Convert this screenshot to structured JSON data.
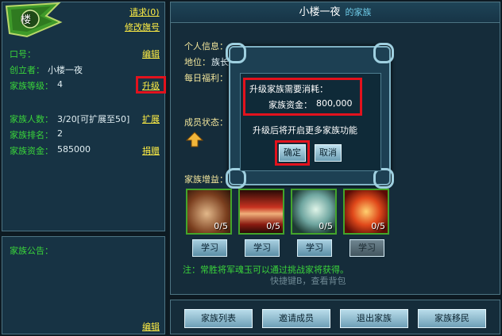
{
  "clan_badge": {
    "char": "楼"
  },
  "left": {
    "request_link": "请求(0)",
    "edit_flag_link": "修改旗号",
    "slogan_label": "口号：",
    "slogan_edit_link": "编辑",
    "creator_label": "创立者：",
    "creator_value": "小楼一夜",
    "level_label": "家族等级：",
    "level_value": "4",
    "upgrade_link": "升级",
    "members_label": "家族人数：",
    "members_value": "3/20[可扩展至50]",
    "expand_link": "扩展",
    "rank_label": "家族排名：",
    "rank_value": "2",
    "funds_label": "家族资金：",
    "funds_value": "585000",
    "donate_link": "捐赠"
  },
  "notice": {
    "label": "家族公告：",
    "edit_link": "编辑"
  },
  "main": {
    "title": "小楼一夜",
    "subtitle": "的家族",
    "personal_info_label": "个人信息：",
    "position_label": "地位：",
    "position_value": "族长",
    "daily_welfare_label": "每日福利：",
    "member_status_label": "成员状态：",
    "buffs_label": "家族增益：",
    "skills": [
      {
        "count": "0/5",
        "learn_label": "学习"
      },
      {
        "count": "0/5",
        "learn_label": "学习"
      },
      {
        "count": "0/5",
        "learn_label": "学习"
      },
      {
        "count": "0/5",
        "learn_label": "学习"
      }
    ],
    "note": "注：常胜将军魂玉可以通过挑战家将获得。",
    "hint": "快捷键B，查看背包"
  },
  "bottom": {
    "clan_list": "家族列表",
    "invite": "邀请成员",
    "leave": "退出家族",
    "migrate": "家族移民"
  },
  "dialog": {
    "cost_title": "升级家族需要消耗：",
    "cost_funds_label": "家族资金：",
    "cost_funds_value": "800,000",
    "unlock_text": "升级后将开启更多家族功能",
    "confirm": "确定",
    "cancel": "取消"
  },
  "colors": {
    "highlight": "#e2121d",
    "label_green": "#3ad43a",
    "link_yellow": "#ffee44"
  }
}
